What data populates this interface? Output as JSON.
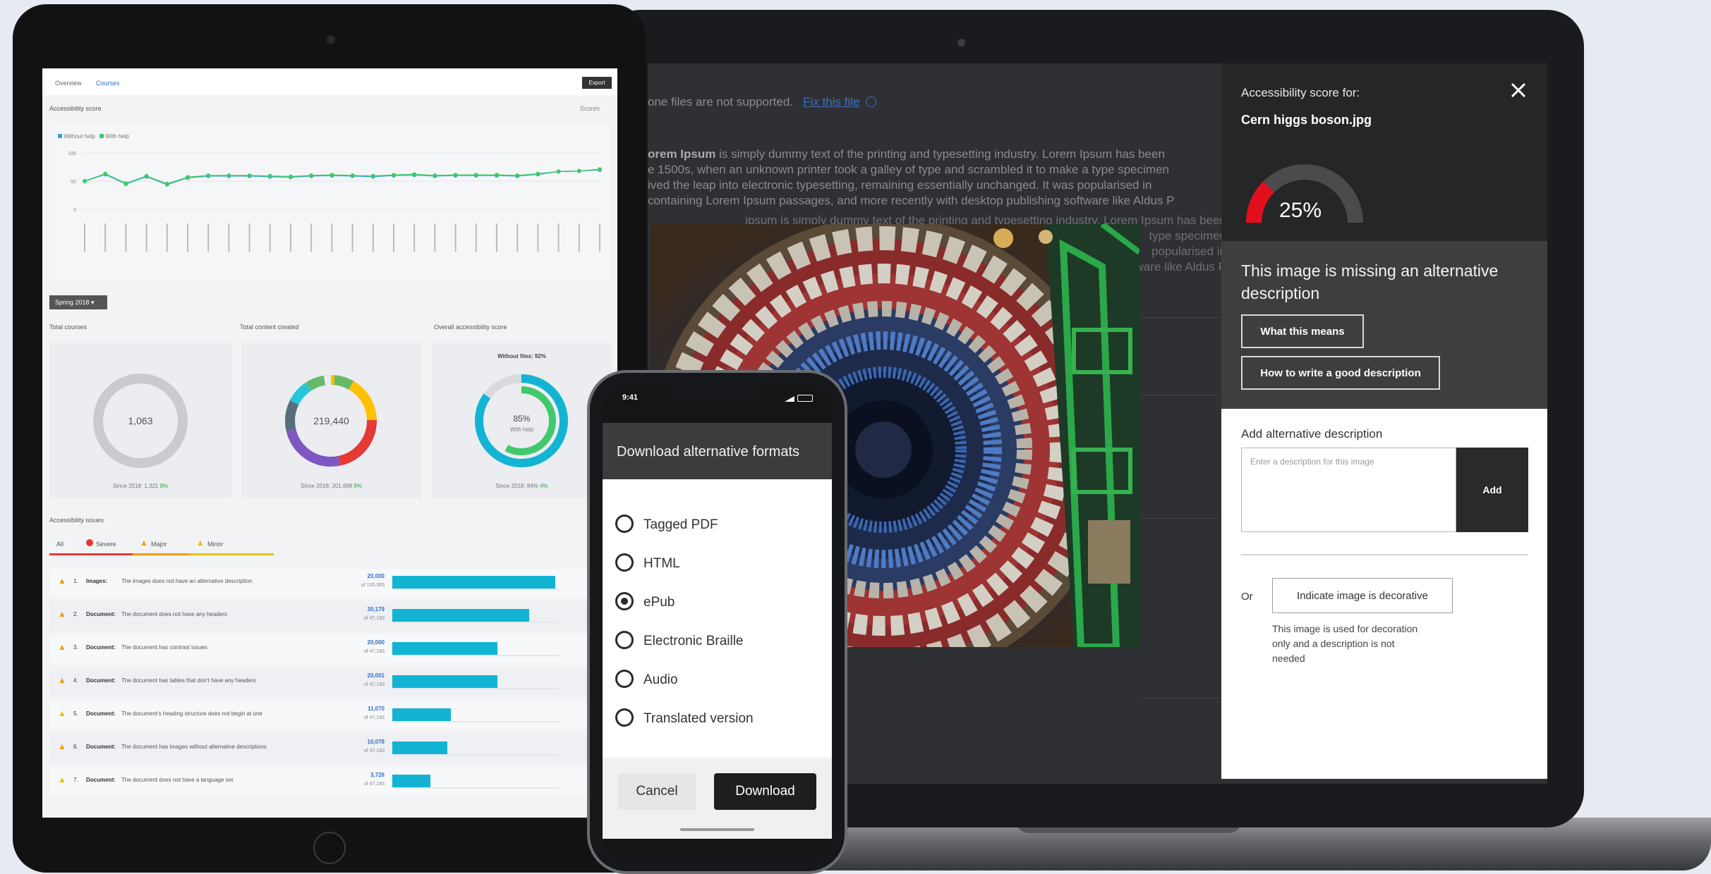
{
  "laptop": {
    "doc_notice": "one files are not supported.",
    "doc_link": "Fix this file",
    "doc_link_icon": "info-circle-icon",
    "doc_bold": "orem Ipsum",
    "doc_lines": [
      " is simply dummy text of the printing and typesetting industry. Lorem Ipsum has been",
      "e 1500s, when an unknown printer took a galley of type and scrambled it to make a type specimen",
      "ived the leap into electronic typesetting, remaining essentially unchanged. It was popularised in",
      "containing Lorem Ipsum passages, and more recently with desktop publishing software like Aldus P"
    ],
    "doc_overflow": [
      "ipsum is simply dummy text of the printing and typesetting industry. Lorem Ipsum has been",
      "type specimen",
      "popularised in",
      "ware like Aldus P"
    ]
  },
  "panel": {
    "heading": "Accessibility score for:",
    "filename": "Cern higgs boson.jpg",
    "close_icon": "close-icon",
    "score_percent": 25,
    "score_label": "25%",
    "missing_message": "This image is missing an alternative description",
    "what_means_button": "What this means",
    "how_to_button": "How to write a good description",
    "add_label": "Add alternative description",
    "add_placeholder": "Enter a description for this image",
    "add_button": "Add",
    "or_label": "Or",
    "decorative_button": "Indicate image is decorative",
    "decorative_note": "This image is used for decoration only and a description is not needed",
    "score_color": "#e30e1b"
  },
  "tablet": {
    "tabs": [
      "Overview",
      "Courses"
    ],
    "export_button": "Export",
    "chart_title": "Accessibility score",
    "chart_filter": "Scores",
    "legend": [
      "Without help",
      "With help"
    ],
    "term_select": "Spring 2018",
    "cards": [
      {
        "title": "Total courses",
        "value": "1,063",
        "foot": "Since 2018: 1,321",
        "delta": "8%"
      },
      {
        "title": "Total content created",
        "value": "219,440",
        "foot": "Since 2018: 201,698",
        "delta": "9%"
      },
      {
        "title": "Overall accessibility score",
        "top": "Without files: 92%",
        "value": "85%",
        "sub": "With help",
        "foot": "Since 2018: 84%",
        "delta": "4%"
      }
    ],
    "issues_title": "Accessibility issues",
    "issue_filters": [
      "All",
      "Severe",
      "Major",
      "Minor"
    ],
    "issues": [
      {
        "num": "1.",
        "type": "Images:",
        "text": "The images does not have an alternative description",
        "count": "20,000",
        "total": "of 105,355",
        "severity": "severe",
        "fraction": 0.98
      },
      {
        "num": "2.",
        "type": "Document:",
        "text": "The document does not have any headers",
        "count": "30,179",
        "total": "of 47,183",
        "severity": "severe",
        "fraction": 0.82
      },
      {
        "num": "3.",
        "type": "Document:",
        "text": "The document has contrast issues",
        "count": "20,000",
        "total": "of 47,183",
        "severity": "severe",
        "fraction": 0.63
      },
      {
        "num": "4.",
        "type": "Document:",
        "text": "The document has tables that don't have any headers",
        "count": "20,001",
        "total": "of 47,183",
        "severity": "severe",
        "fraction": 0.63
      },
      {
        "num": "5.",
        "type": "Document:",
        "text": "The document's heading structure does not begin at one",
        "count": "11,070",
        "total": "of 47,183",
        "severity": "minor",
        "fraction": 0.35
      },
      {
        "num": "6.",
        "type": "Document:",
        "text": "The document has images without alternative descriptions",
        "count": "10,078",
        "total": "of 47,183",
        "severity": "severe",
        "fraction": 0.33
      },
      {
        "num": "7.",
        "type": "Document:",
        "text": "The document does not have a language set",
        "count": "3,726",
        "total": "of 47,183",
        "severity": "minor",
        "fraction": 0.23
      }
    ]
  },
  "chart_data": {
    "type": "line",
    "title": "Accessibility score",
    "series": [
      {
        "name": "Without help",
        "values": [
          50,
          62,
          45,
          58,
          44,
          56,
          59,
          59,
          59,
          58,
          57,
          59,
          60,
          59,
          58,
          60,
          61,
          59,
          60,
          60,
          60,
          59,
          62,
          67,
          68,
          70
        ]
      },
      {
        "name": "With help",
        "values": [
          50,
          63,
          46,
          59,
          45,
          57,
          60,
          60,
          60,
          59,
          58,
          60,
          61,
          60,
          59,
          61,
          62,
          60,
          61,
          61,
          61,
          60,
          63,
          67,
          68,
          71
        ]
      }
    ],
    "yticks": [
      100,
      50,
      0
    ],
    "ylim": [
      0,
      100
    ],
    "colors": [
      "#3aa3d6",
      "#41c86d"
    ]
  },
  "phone": {
    "time": "9:41",
    "title": "Download alternative formats",
    "options": [
      "Tagged PDF",
      "HTML",
      "ePub",
      "Electronic Braille",
      "Audio",
      "Translated version"
    ],
    "selected_index": 2,
    "cancel_button": "Cancel",
    "download_button": "Download"
  }
}
